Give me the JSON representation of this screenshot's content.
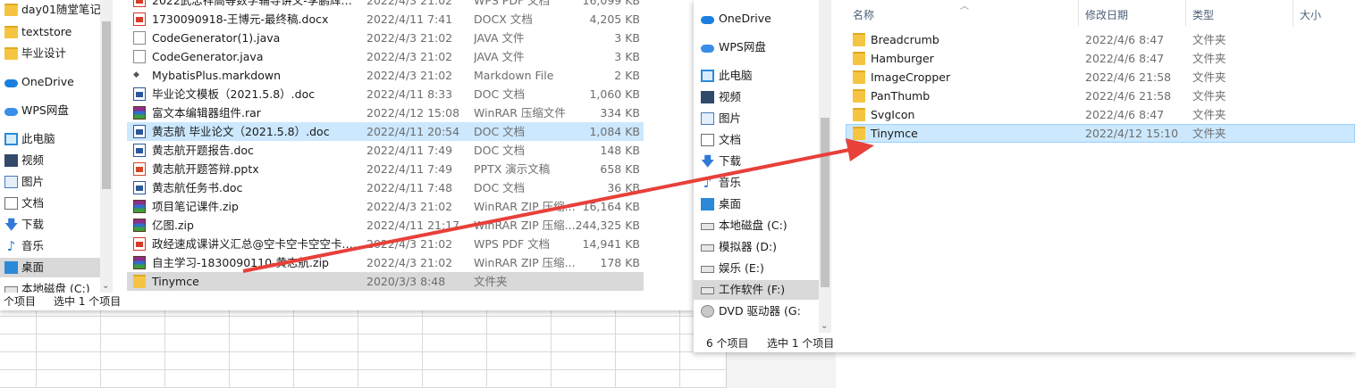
{
  "left_window": {
    "nav": [
      {
        "label": "day01随堂笔记",
        "icon": "folder-icon"
      },
      {
        "label": "textstore",
        "icon": "folder-icon"
      },
      {
        "label": "毕业设计",
        "icon": "folder-icon"
      },
      {
        "label": "OneDrive",
        "icon": "onedrive-icon"
      },
      {
        "label": "WPS网盘",
        "icon": "wps-cloud-icon"
      },
      {
        "label": "此电脑",
        "icon": "this-pc-icon"
      },
      {
        "label": "视频",
        "icon": "videos-icon"
      },
      {
        "label": "图片",
        "icon": "pictures-icon"
      },
      {
        "label": "文档",
        "icon": "documents-icon"
      },
      {
        "label": "下载",
        "icon": "downloads-icon"
      },
      {
        "label": "音乐",
        "icon": "music-icon"
      },
      {
        "label": "桌面",
        "icon": "desktop-icon"
      },
      {
        "label": "本地磁盘 (C:)",
        "icon": "drive-icon"
      }
    ],
    "files": [
      {
        "name": "2022武忠祥高等数学辅导讲义-李鹏辉版...",
        "date": "2022/4/3 21:02",
        "type": "WPS PDF 文档",
        "size": "16,099 KB",
        "icon": "pdf"
      },
      {
        "name": "1730090918-王博元-最终稿.docx",
        "date": "2022/4/11 7:41",
        "type": "DOCX 文档",
        "size": "4,205 KB",
        "icon": "pdf"
      },
      {
        "name": "CodeGenerator(1).java",
        "date": "2022/4/3 21:02",
        "type": "JAVA 文件",
        "size": "3 KB",
        "icon": "doc"
      },
      {
        "name": "CodeGenerator.java",
        "date": "2022/4/3 21:02",
        "type": "JAVA 文件",
        "size": "3 KB",
        "icon": "doc"
      },
      {
        "name": "MybatisPlus.markdown",
        "date": "2022/4/3 21:02",
        "type": "Markdown File",
        "size": "2 KB",
        "icon": "md"
      },
      {
        "name": "毕业论文模板（2021.5.8）.doc",
        "date": "2022/4/11 8:33",
        "type": "DOC 文档",
        "size": "1,060 KB",
        "icon": "word"
      },
      {
        "name": "富文本编辑器组件.rar",
        "date": "2022/4/12 15:08",
        "type": "WinRAR 压缩文件",
        "size": "334 KB",
        "icon": "rar"
      },
      {
        "name": "黄志航 毕业论文（2021.5.8）.doc",
        "date": "2022/4/11 20:54",
        "type": "DOC 文档",
        "size": "1,084 KB",
        "icon": "word"
      },
      {
        "name": "黄志航开题报告.doc",
        "date": "2022/4/11 7:49",
        "type": "DOC 文档",
        "size": "148 KB",
        "icon": "word"
      },
      {
        "name": "黄志航开题答辩.pptx",
        "date": "2022/4/11 7:49",
        "type": "PPTX 演示文稿",
        "size": "658 KB",
        "icon": "ppt"
      },
      {
        "name": "黄志航任务书.doc",
        "date": "2022/4/11 7:48",
        "type": "DOC 文档",
        "size": "36 KB",
        "icon": "word"
      },
      {
        "name": "项目笔记课件.zip",
        "date": "2022/4/3 21:02",
        "type": "WinRAR ZIP 压缩...",
        "size": "16,164 KB",
        "icon": "rar"
      },
      {
        "name": "亿图.zip",
        "date": "2022/4/11 21:17",
        "type": "WinRAR ZIP 压缩...",
        "size": "244,325 KB",
        "icon": "rar"
      },
      {
        "name": "政经速成课讲义汇总@空卡空卡空空卡.p...",
        "date": "2022/4/3 21:02",
        "type": "WPS PDF 文档",
        "size": "14,941 KB",
        "icon": "pdf"
      },
      {
        "name": "自主学习-1830090110-黄志航.zip",
        "date": "2022/4/3 21:02",
        "type": "WinRAR ZIP 压缩...",
        "size": "178 KB",
        "icon": "rar"
      },
      {
        "name": "Tinymce",
        "date": "2020/3/3 8:48",
        "type": "文件夹",
        "size": "",
        "icon": "folder"
      }
    ],
    "status_count": "个项目",
    "status_selected": "选中 1 个项目"
  },
  "right_window": {
    "nav": [
      {
        "label": "OneDrive",
        "icon": "onedrive-icon"
      },
      {
        "label": "WPS网盘",
        "icon": "wps-cloud-icon"
      },
      {
        "label": "此电脑",
        "icon": "this-pc-icon"
      },
      {
        "label": "视频",
        "icon": "videos-icon"
      },
      {
        "label": "图片",
        "icon": "pictures-icon"
      },
      {
        "label": "文档",
        "icon": "documents-icon"
      },
      {
        "label": "下载",
        "icon": "downloads-icon"
      },
      {
        "label": "音乐",
        "icon": "music-icon"
      },
      {
        "label": "桌面",
        "icon": "desktop-icon"
      },
      {
        "label": "本地磁盘 (C:)",
        "icon": "drive-icon"
      },
      {
        "label": "模拟器 (D:)",
        "icon": "drive-icon"
      },
      {
        "label": "娱乐 (E:)",
        "icon": "drive-icon"
      },
      {
        "label": "工作软件 (F:)",
        "icon": "drive-icon"
      },
      {
        "label": "DVD 驱动器 (G:",
        "icon": "dvd-icon"
      }
    ],
    "columns": {
      "name": "名称",
      "date": "修改日期",
      "type": "类型",
      "size": "大小"
    },
    "files": [
      {
        "name": "Breadcrumb",
        "date": "2022/4/6 8:47",
        "type": "文件夹"
      },
      {
        "name": "Hamburger",
        "date": "2022/4/6 8:47",
        "type": "文件夹"
      },
      {
        "name": "ImageCropper",
        "date": "2022/4/6 21:58",
        "type": "文件夹"
      },
      {
        "name": "PanThumb",
        "date": "2022/4/6 21:58",
        "type": "文件夹"
      },
      {
        "name": "SvgIcon",
        "date": "2022/4/6 8:47",
        "type": "文件夹"
      },
      {
        "name": "Tinymce",
        "date": "2022/4/12 15:10",
        "type": "文件夹"
      }
    ],
    "status_count": "6 个项目",
    "status_selected": "选中 1 个项目"
  },
  "colors": {
    "selection": "#cce8ff",
    "highlight": "#d9d9d9",
    "arrow": "#e8403a"
  }
}
